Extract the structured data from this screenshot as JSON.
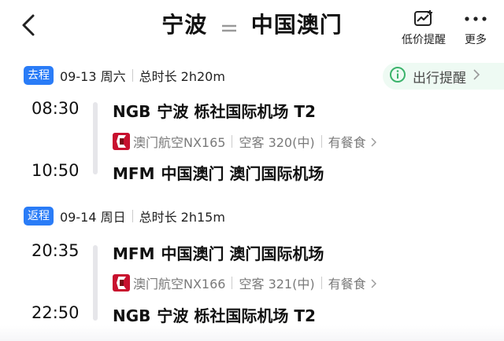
{
  "header": {
    "origin": "宁波",
    "destination": "中国澳门",
    "price_alert_label": "低价提醒",
    "more_label": "更多"
  },
  "outbound": {
    "tag": "去程",
    "date": "09-13 周六",
    "duration": "总时长 2h20m",
    "dep_time": "08:30",
    "dep_code": "NGB",
    "dep_airport": "宁波 栎社国际机场 T2",
    "airline_flight": "澳门航空NX165",
    "aircraft": "空客 320(中)",
    "meal": "有餐食",
    "arr_time": "10:50",
    "arr_code": "MFM",
    "arr_airport": "中国澳门 澳门国际机场"
  },
  "travel_reminder": {
    "label": "出行提醒"
  },
  "return": {
    "tag": "返程",
    "date": "09-14 周日",
    "duration": "总时长 2h15m",
    "dep_time": "20:35",
    "dep_code": "MFM",
    "dep_airport": "中国澳门 澳门国际机场",
    "airline_flight": "澳门航空NX166",
    "aircraft": "空客 321(中)",
    "meal": "有餐食",
    "arr_time": "22:50",
    "arr_code": "NGB",
    "arr_airport": "宁波 栎社国际机场 T2"
  },
  "colors": {
    "accent": "#2a7cf7",
    "reminder_bg": "#eefaf3",
    "airline": "#c8102e"
  },
  "icons": [
    "back-icon",
    "round-trip-icon",
    "price-chart-icon",
    "more-dots-icon",
    "info-icon",
    "chevron-right-icon",
    "airline-logo"
  ]
}
